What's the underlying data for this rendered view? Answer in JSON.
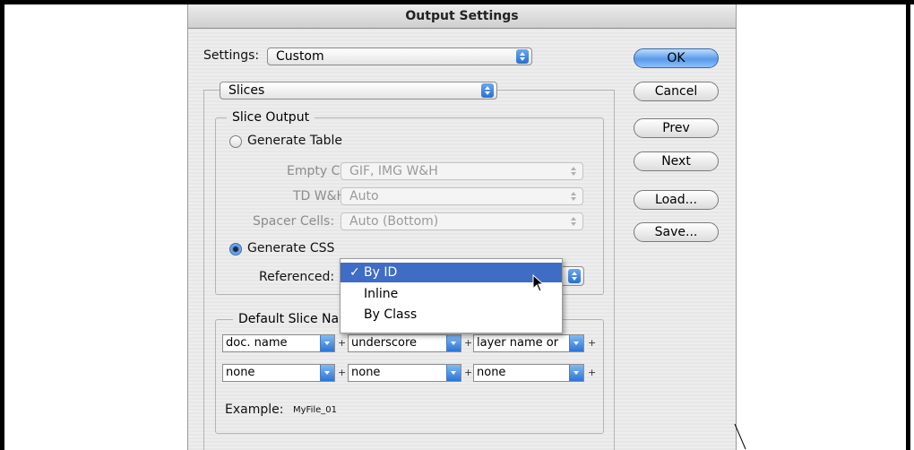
{
  "dialog": {
    "title": "Output Settings"
  },
  "settings": {
    "label": "Settings:",
    "value": "Custom"
  },
  "section_popup": {
    "value": "Slices"
  },
  "buttons": {
    "ok": "OK",
    "cancel": "Cancel",
    "prev": "Prev",
    "next": "Next",
    "load": "Load...",
    "save": "Save..."
  },
  "slice_output": {
    "legend": "Slice Output",
    "generate_table": "Generate Table",
    "empty_cells": {
      "label": "Empty Cells:",
      "value": "GIF, IMG W&H"
    },
    "td_wh": {
      "label": "TD W&H:",
      "value": "Auto"
    },
    "spacer_cells": {
      "label": "Spacer Cells:",
      "value": "Auto (Bottom)"
    },
    "generate_css": "Generate CSS",
    "referenced": {
      "label": "Referenced:"
    },
    "selected": "generate_css"
  },
  "referenced_menu": {
    "check": "✓",
    "items": [
      "By ID",
      "Inline",
      "By Class"
    ],
    "selected_index": 0
  },
  "default_naming": {
    "legend": "Default Slice Na",
    "row1": [
      "doc. name",
      "underscore",
      "layer name or"
    ],
    "row2": [
      "none",
      "none",
      "none"
    ],
    "plus": "+",
    "example_label": "Example:",
    "example_value": "MyFile_01"
  },
  "colors": {
    "accent": "#3f6cc4",
    "default_button": "#5a9ae8"
  },
  "icons": {
    "cursor": "arrow-cursor-icon",
    "check": "checkmark-icon",
    "dropdown": "chevron-down-icon",
    "stepper": "up-down-arrows-icon"
  }
}
